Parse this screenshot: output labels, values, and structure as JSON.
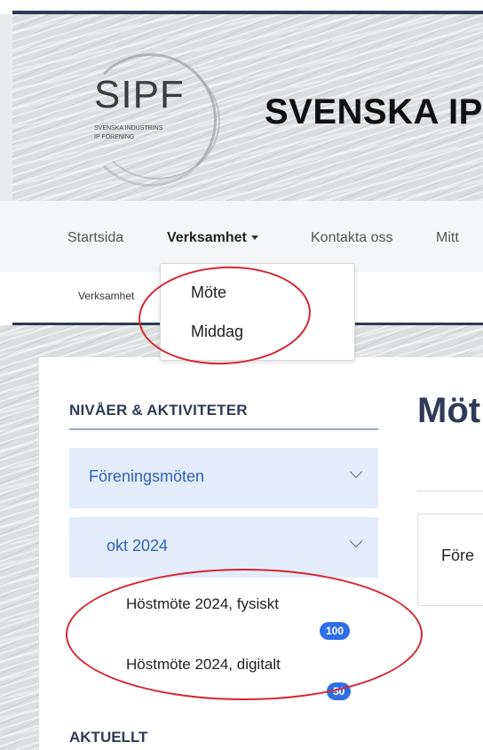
{
  "header": {
    "logo_text": "SIPF",
    "logo_subtitle_1": "SVENSKA INDUSTRINS",
    "logo_subtitle_2": "IP FÖRENING",
    "site_title": "SVENSKA IP"
  },
  "nav": {
    "items": [
      {
        "label": "Startsida"
      },
      {
        "label": "Verksamhet"
      },
      {
        "label": "Kontakta oss"
      },
      {
        "label": "Mitt"
      }
    ]
  },
  "breadcrumb": "Verksamhet",
  "dropdown": {
    "items": [
      {
        "label": "Möte"
      },
      {
        "label": "Middag"
      }
    ]
  },
  "sidebar": {
    "heading": "NIVÅER & AKTIVITETER",
    "accordion": [
      {
        "label": "Föreningsmöten"
      },
      {
        "label": "okt 2024"
      }
    ],
    "events": [
      {
        "label": "Höstmöte 2024, fysiskt",
        "count": "100"
      },
      {
        "label": "Höstmöte 2024, digitalt",
        "count": "50"
      }
    ],
    "aktuellt_heading": "AKTUELLT"
  },
  "main": {
    "title": "Möt",
    "card_text": "Före"
  },
  "colors": {
    "navy": "#2f3a57",
    "link_blue": "#2f62b5",
    "accordion_bg": "#e3ecfa",
    "badge_blue": "#2e6ee6",
    "annotation_red": "#d6262f"
  }
}
